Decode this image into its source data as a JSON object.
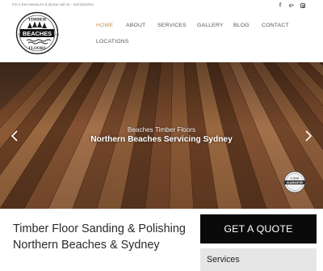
{
  "topbar": {
    "text": "For a free Measure & Quote call us - 0401184444",
    "social": [
      {
        "icon": "facebook-icon",
        "glyph": "f"
      },
      {
        "icon": "google-plus-icon",
        "glyph": "g+"
      },
      {
        "icon": "instagram-icon",
        "glyph": ""
      }
    ]
  },
  "logo": {
    "top_text": "TIMBER",
    "main_text": "BEACHES",
    "bottom_text": "FLOORS",
    "left_mark": "EST",
    "right_mark": "1998"
  },
  "nav": {
    "items": [
      {
        "label": "HOME",
        "active": true
      },
      {
        "label": "ABOUT",
        "active": false
      },
      {
        "label": "SERVICES",
        "active": false
      },
      {
        "label": "GALLERY",
        "active": false
      },
      {
        "label": "BLOG",
        "active": false
      },
      {
        "label": "CONTACT",
        "active": false
      },
      {
        "label": "LOCATIONS",
        "active": false
      }
    ],
    "active_color": "#c8945a"
  },
  "hero": {
    "subtitle": "Beaches Timber Floors",
    "title": "Northern Beaches Servicing Sydney",
    "badge_top": "5 YEAR",
    "badge_main": "GUARANTEE"
  },
  "main": {
    "title": "Timber Floor Sanding & Polishing Northern Beaches & Sydney"
  },
  "sidebar": {
    "quote_button": "GET A QUOTE",
    "services_label": "Services"
  }
}
